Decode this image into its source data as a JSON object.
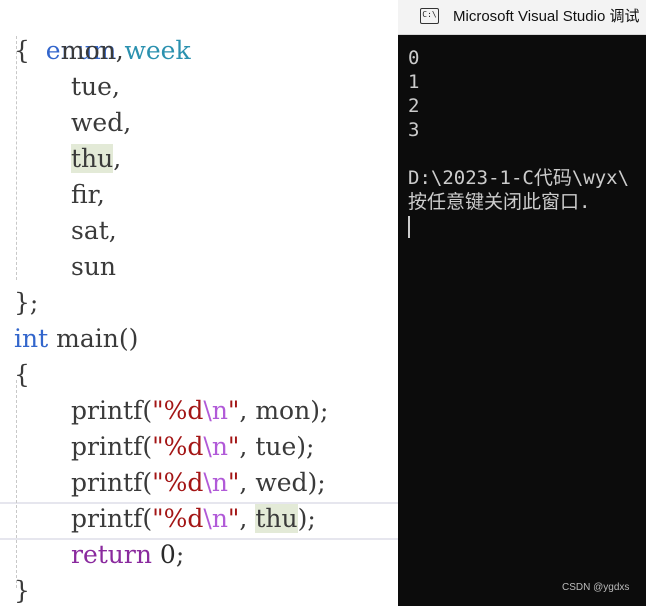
{
  "editor": {
    "enum_keyword": "enum",
    "enum_name": "week",
    "open_brace": "{",
    "members": [
      "mon,",
      "tue,",
      "wed,",
      "thu",
      "fir,",
      "sat,",
      "sun"
    ],
    "thu_comma": ",",
    "close_enum": "};",
    "main_type": "int",
    "main_name": "main",
    "main_parens": "()",
    "body_open": "{",
    "printf": "printf",
    "paren_open": "(",
    "quote_open": "\"",
    "fmt": "%d",
    "escape": "\\n",
    "quote_close": "\"",
    "comma": ", ",
    "args": [
      "mon",
      "tue",
      "wed",
      "thu"
    ],
    "stmt_end": ");",
    "return_keyword": "return",
    "return_value": "0",
    "semicolon": ";",
    "body_close": "}"
  },
  "console": {
    "icon_text": "C:\\",
    "title": "Microsoft Visual Studio 调试",
    "output_lines": [
      "0",
      "1",
      "2",
      "3"
    ],
    "path_line": "D:\\2023-1-C代码\\wyx\\",
    "press_key": "按任意键关闭此窗口. "
  },
  "watermark": "CSDN @ygdxs"
}
